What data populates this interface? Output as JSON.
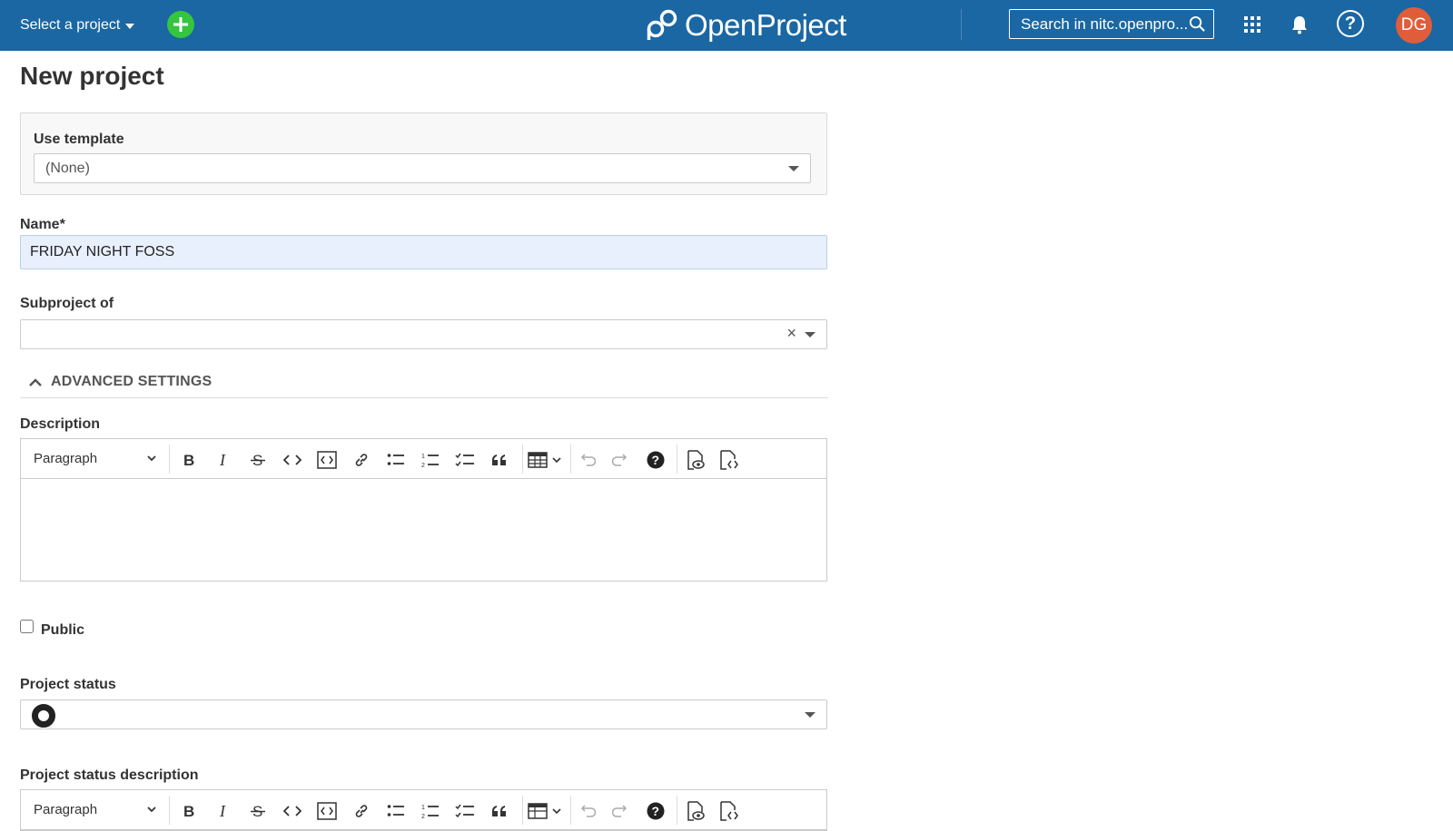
{
  "header": {
    "project_select": "Select a project",
    "logo_text": "OpenProject",
    "search_placeholder": "Search in nitc.openpro...",
    "avatar_initials": "DG",
    "help_glyph": "?"
  },
  "page": {
    "title": "New project"
  },
  "form": {
    "template": {
      "label": "Use template",
      "value": "(None)"
    },
    "name": {
      "label": "Name*",
      "value": "FRIDAY NIGHT FOSS"
    },
    "subproject": {
      "label": "Subproject of",
      "value": "",
      "clear_glyph": "×"
    },
    "advanced_settings": "ADVANCED SETTINGS",
    "description": {
      "label": "Description",
      "paragraph": "Paragraph"
    },
    "public": {
      "label": "Public",
      "checked": false
    },
    "status": {
      "label": "Project status",
      "value": ""
    },
    "status_description": {
      "label": "Project status description",
      "paragraph": "Paragraph"
    }
  },
  "icons": {
    "toolbar": [
      "bold-icon",
      "italic-icon",
      "strikethrough-icon",
      "code-icon",
      "code-block-icon",
      "link-icon",
      "bulleted-list-icon",
      "numbered-list-icon",
      "todo-list-icon",
      "quote-icon",
      "table-icon",
      "undo-icon",
      "redo-icon",
      "help-icon",
      "preview-icon",
      "source-icon"
    ]
  },
  "colors": {
    "header_bg": "#1a67a3",
    "add_button": "#35c53f",
    "avatar_bg": "#e05d3a",
    "name_field_bg": "#e8f0fd"
  }
}
